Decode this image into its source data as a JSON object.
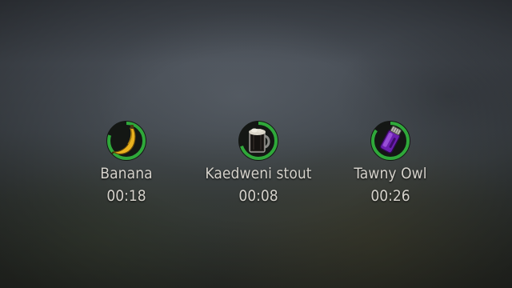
{
  "effects": [
    {
      "name": "Banana",
      "time": "00:18",
      "icon": "banana-icon",
      "progress": 0.8
    },
    {
      "name": "Kaedweni stout",
      "time": "00:08",
      "icon": "beer-mug-icon",
      "progress": 0.7
    },
    {
      "name": "Tawny Owl",
      "time": "00:26",
      "icon": "potion-vial-icon",
      "progress": 0.85
    }
  ],
  "colors": {
    "ring_progress": "#2fa83a",
    "ring_track": "#1a1d1a",
    "text": "#d5d2cb"
  }
}
